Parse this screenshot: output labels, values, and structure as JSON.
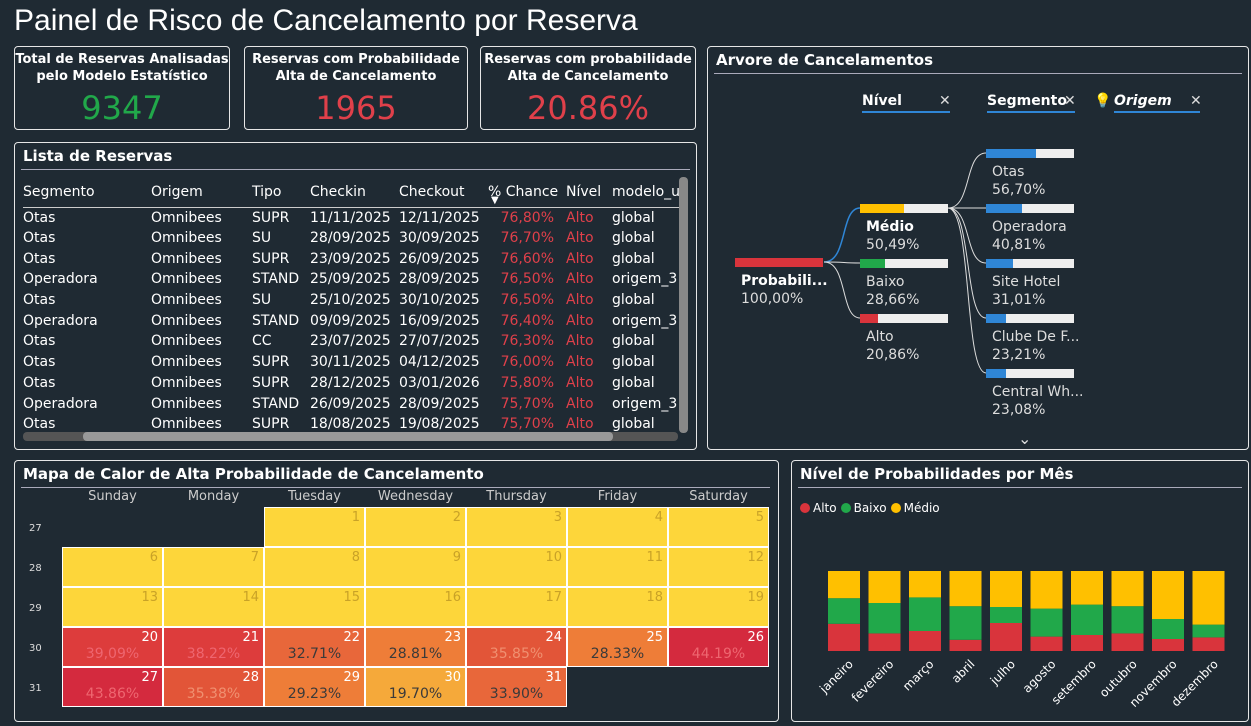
{
  "page_title": "Painel de Risco de Cancelamento por Reserva",
  "kpis": [
    {
      "label": "Total de Reservas Analisadas pelo Modelo Estatístico",
      "value": "9347",
      "color": "#21a84a"
    },
    {
      "label": "Reservas com Probabilidade Alta de Cancelamento",
      "value": "1965",
      "color": "#e0404a"
    },
    {
      "label": "Reservas com probabilidade Alta de Cancelamento",
      "value": "20.86%",
      "color": "#e0404a"
    }
  ],
  "lista": {
    "title": "Lista de Reservas",
    "columns": [
      "Segmento",
      "Origem",
      "Tipo",
      "Checkin",
      "Checkout",
      "% Chance",
      "Nível",
      "modelo_u"
    ],
    "rows": [
      [
        "Otas",
        "Omnibees",
        "SUPR",
        "11/11/2025",
        "12/11/2025",
        "76,80%",
        "Alto",
        "global"
      ],
      [
        "Otas",
        "Omnibees",
        "SU",
        "28/09/2025",
        "30/09/2025",
        "76,70%",
        "Alto",
        "global"
      ],
      [
        "Otas",
        "Omnibees",
        "SUPR",
        "23/09/2025",
        "26/09/2025",
        "76,60%",
        "Alto",
        "global"
      ],
      [
        "Operadora",
        "Omnibees",
        "STAND",
        "25/09/2025",
        "28/09/2025",
        "76,50%",
        "Alto",
        "origem_3"
      ],
      [
        "Otas",
        "Omnibees",
        "SU",
        "25/10/2025",
        "30/10/2025",
        "76,50%",
        "Alto",
        "global"
      ],
      [
        "Operadora",
        "Omnibees",
        "STAND",
        "09/09/2025",
        "16/09/2025",
        "76,40%",
        "Alto",
        "origem_3"
      ],
      [
        "Otas",
        "Omnibees",
        "CC",
        "23/07/2025",
        "27/07/2025",
        "76,30%",
        "Alto",
        "global"
      ],
      [
        "Otas",
        "Omnibees",
        "SUPR",
        "30/11/2025",
        "04/12/2025",
        "76,00%",
        "Alto",
        "global"
      ],
      [
        "Otas",
        "Omnibees",
        "SUPR",
        "28/12/2025",
        "03/01/2026",
        "75,80%",
        "Alto",
        "global"
      ],
      [
        "Operadora",
        "Omnibees",
        "STAND",
        "26/09/2025",
        "28/09/2025",
        "75,70%",
        "Alto",
        "origem_3"
      ],
      [
        "Otas",
        "Omnibees",
        "SUPR",
        "18/08/2025",
        "19/08/2025",
        "75,70%",
        "Alto",
        "global"
      ]
    ]
  },
  "arvore": {
    "title": "Arvore de Cancelamentos",
    "headers": [
      "Nível",
      "Segmento",
      "Origem"
    ],
    "root": {
      "label": "Probabili...",
      "value": "100,00%",
      "fill": 1.0,
      "color": "#d9343c"
    },
    "nivel": [
      {
        "label": "Médio",
        "value": "50,49%",
        "fill": 0.5049,
        "color": "#ffc000"
      },
      {
        "label": "Baixo",
        "value": "28,66%",
        "fill": 0.2866,
        "color": "#21a84a"
      },
      {
        "label": "Alto",
        "value": "20,86%",
        "fill": 0.2086,
        "color": "#d9343c"
      }
    ],
    "segmento": [
      {
        "label": "Otas",
        "value": "56,70%",
        "fill": 0.567,
        "color": "#2f86d6"
      },
      {
        "label": "Operadora",
        "value": "40,81%",
        "fill": 0.4081,
        "color": "#2f86d6"
      },
      {
        "label": "Site Hotel",
        "value": "31,01%",
        "fill": 0.3101,
        "color": "#2f86d6"
      },
      {
        "label": "Clube De F...",
        "value": "23,21%",
        "fill": 0.2321,
        "color": "#2f86d6"
      },
      {
        "label": "Central Wh...",
        "value": "23,08%",
        "fill": 0.2308,
        "color": "#2f86d6"
      }
    ]
  },
  "mapa": {
    "title": "Mapa de Calor de Alta Probabilidade de Cancelamento",
    "days": [
      "Sunday",
      "Monday",
      "Tuesday",
      "Wednesday",
      "Thursday",
      "Friday",
      "Saturday"
    ],
    "weeks": [
      "27",
      "28",
      "29",
      "30",
      "31"
    ],
    "cells": [
      {
        "w": 0,
        "d": 2,
        "day": "1",
        "pct": ""
      },
      {
        "w": 0,
        "d": 3,
        "day": "2",
        "pct": ""
      },
      {
        "w": 0,
        "d": 4,
        "day": "3",
        "pct": ""
      },
      {
        "w": 0,
        "d": 5,
        "day": "4",
        "pct": ""
      },
      {
        "w": 0,
        "d": 6,
        "day": "5",
        "pct": ""
      },
      {
        "w": 1,
        "d": 0,
        "day": "6",
        "pct": ""
      },
      {
        "w": 1,
        "d": 1,
        "day": "7",
        "pct": ""
      },
      {
        "w": 1,
        "d": 2,
        "day": "8",
        "pct": ""
      },
      {
        "w": 1,
        "d": 3,
        "day": "9",
        "pct": ""
      },
      {
        "w": 1,
        "d": 4,
        "day": "10",
        "pct": ""
      },
      {
        "w": 1,
        "d": 5,
        "day": "11",
        "pct": ""
      },
      {
        "w": 1,
        "d": 6,
        "day": "12",
        "pct": ""
      },
      {
        "w": 2,
        "d": 0,
        "day": "13",
        "pct": ""
      },
      {
        "w": 2,
        "d": 1,
        "day": "14",
        "pct": ""
      },
      {
        "w": 2,
        "d": 2,
        "day": "15",
        "pct": ""
      },
      {
        "w": 2,
        "d": 3,
        "day": "16",
        "pct": ""
      },
      {
        "w": 2,
        "d": 4,
        "day": "17",
        "pct": ""
      },
      {
        "w": 2,
        "d": 5,
        "day": "18",
        "pct": ""
      },
      {
        "w": 2,
        "d": 6,
        "day": "19",
        "pct": ""
      },
      {
        "w": 3,
        "d": 0,
        "day": "20",
        "pct": "39,09%"
      },
      {
        "w": 3,
        "d": 1,
        "day": "21",
        "pct": "38.22%"
      },
      {
        "w": 3,
        "d": 2,
        "day": "22",
        "pct": "32.71%"
      },
      {
        "w": 3,
        "d": 3,
        "day": "23",
        "pct": "28.81%"
      },
      {
        "w": 3,
        "d": 4,
        "day": "24",
        "pct": "35.85%"
      },
      {
        "w": 3,
        "d": 5,
        "day": "25",
        "pct": "28.33%"
      },
      {
        "w": 3,
        "d": 6,
        "day": "26",
        "pct": "44.19%"
      },
      {
        "w": 4,
        "d": 0,
        "day": "27",
        "pct": "43.86%"
      },
      {
        "w": 4,
        "d": 1,
        "day": "28",
        "pct": "35.38%"
      },
      {
        "w": 4,
        "d": 2,
        "day": "29",
        "pct": "29.23%"
      },
      {
        "w": 4,
        "d": 3,
        "day": "30",
        "pct": "19.70%"
      },
      {
        "w": 4,
        "d": 4,
        "day": "31",
        "pct": "33.90%"
      }
    ]
  },
  "chart_data": {
    "type": "bar",
    "title": "Nível de Probabilidades por Mês",
    "categories": [
      "janeiro",
      "fevereiro",
      "março",
      "abril",
      "julho",
      "agosto",
      "setembro",
      "outubro",
      "novembro",
      "dezembro"
    ],
    "series": [
      {
        "name": "Alto",
        "color": "#d9343c",
        "values": [
          34,
          22,
          25,
          14,
          35,
          18,
          20,
          22,
          15,
          17
        ]
      },
      {
        "name": "Baixo",
        "color": "#21a84a",
        "values": [
          32,
          38,
          42,
          42,
          20,
          35,
          38,
          34,
          25,
          16
        ]
      },
      {
        "name": "Médio",
        "color": "#ffc000",
        "values": [
          34,
          40,
          33,
          44,
          45,
          47,
          42,
          44,
          60,
          67
        ]
      }
    ],
    "stacked": true,
    "ylim": [
      0,
      100
    ],
    "legend": "top-left"
  }
}
